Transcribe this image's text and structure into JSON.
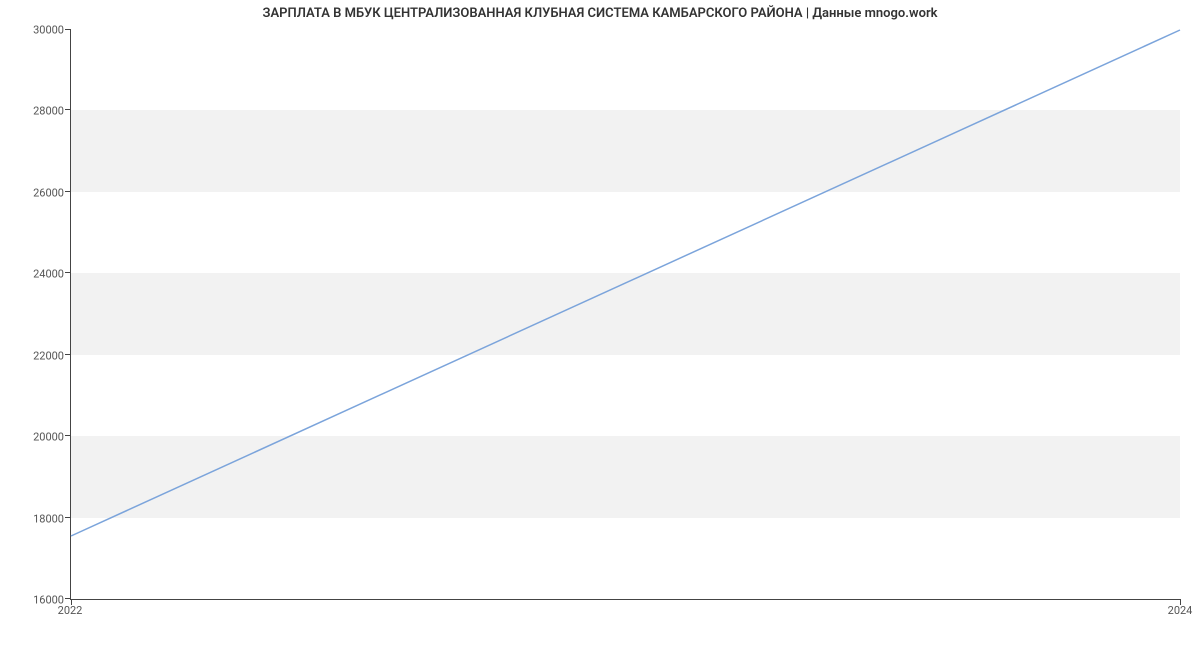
{
  "chart_data": {
    "type": "line",
    "title": "ЗАРПЛАТА В МБУК ЦЕНТРАЛИЗОВАННАЯ КЛУБНАЯ СИСТЕМА КАМБАРСКОГО РАЙОНА | Данные mnogo.work",
    "x": [
      2022,
      2024
    ],
    "values": [
      17550,
      30000
    ],
    "xlabel": "",
    "ylabel": "",
    "xlim": [
      2022,
      2024
    ],
    "ylim": [
      16000,
      30000
    ],
    "yticks": [
      16000,
      18000,
      20000,
      22000,
      24000,
      26000,
      28000,
      30000
    ],
    "xticks": [
      2022,
      2024
    ],
    "line_color": "#7ba4db",
    "band_color": "#f2f2f2"
  }
}
